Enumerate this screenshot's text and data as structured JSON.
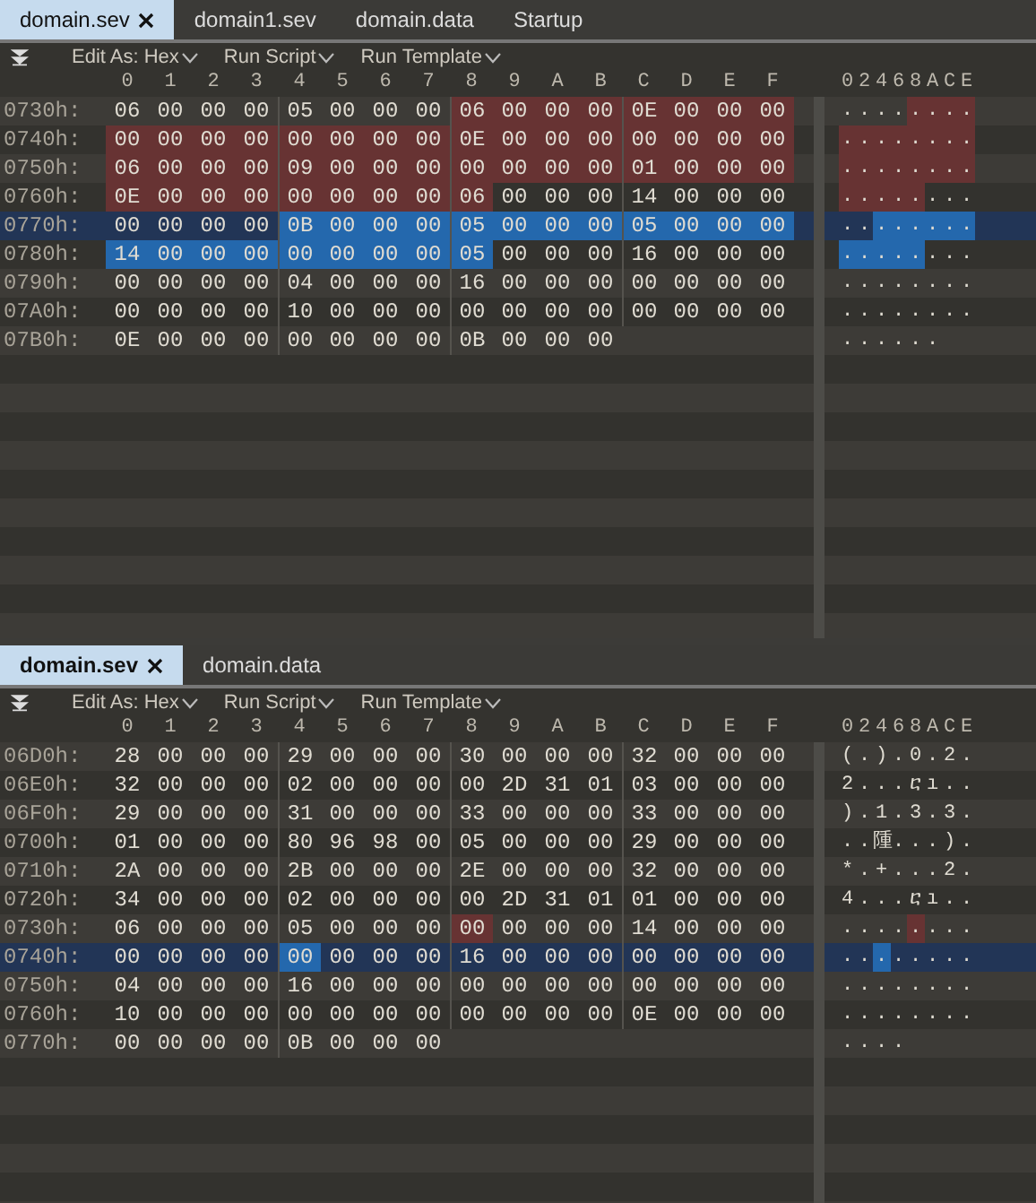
{
  "panes": [
    {
      "tabs": [
        {
          "label": "domain.sev",
          "selected": true,
          "focused": false,
          "closable": true
        },
        {
          "label": "domain1.sev",
          "selected": false,
          "focused": false,
          "closable": false
        },
        {
          "label": "domain.data",
          "selected": false,
          "focused": false,
          "closable": false
        },
        {
          "label": "Startup",
          "selected": false,
          "focused": false,
          "closable": false
        }
      ],
      "toolbar": [
        "Edit As: Hex",
        "Run Script",
        "Run Template"
      ],
      "columns": [
        "0",
        "1",
        "2",
        "3",
        "4",
        "5",
        "6",
        "7",
        "8",
        "9",
        "A",
        "B",
        "C",
        "D",
        "E",
        "F"
      ],
      "text_columns": [
        "0",
        "2",
        "4",
        "6",
        "8",
        "A",
        "C",
        "E"
      ],
      "rows": [
        {
          "offset": "0730h:",
          "selected": false,
          "bytes": [
            "06",
            "00",
            "00",
            "00",
            "05",
            "00",
            "00",
            "00",
            "06",
            "00",
            "00",
            "00",
            "0E",
            "00",
            "00",
            "00"
          ],
          "in_template": [
            false,
            false,
            false,
            false,
            false,
            false,
            false,
            false,
            true,
            true,
            true,
            true,
            true,
            true,
            true,
            true
          ],
          "selected_bytes": [
            false,
            false,
            false,
            false,
            false,
            false,
            false,
            false,
            false,
            false,
            false,
            false,
            false,
            false,
            false,
            false
          ],
          "text": "........"
        },
        {
          "offset": "0740h:",
          "selected": false,
          "bytes": [
            "00",
            "00",
            "00",
            "00",
            "00",
            "00",
            "00",
            "00",
            "0E",
            "00",
            "00",
            "00",
            "00",
            "00",
            "00",
            "00"
          ],
          "in_template": [
            true,
            true,
            true,
            true,
            true,
            true,
            true,
            true,
            true,
            true,
            true,
            true,
            true,
            true,
            true,
            true
          ],
          "selected_bytes": [
            false,
            false,
            false,
            false,
            false,
            false,
            false,
            false,
            false,
            false,
            false,
            false,
            false,
            false,
            false,
            false
          ],
          "text": "........"
        },
        {
          "offset": "0750h:",
          "selected": false,
          "bytes": [
            "06",
            "00",
            "00",
            "00",
            "09",
            "00",
            "00",
            "00",
            "00",
            "00",
            "00",
            "00",
            "01",
            "00",
            "00",
            "00"
          ],
          "in_template": [
            true,
            true,
            true,
            true,
            true,
            true,
            true,
            true,
            true,
            true,
            true,
            true,
            true,
            true,
            true,
            true
          ],
          "selected_bytes": [
            false,
            false,
            false,
            false,
            false,
            false,
            false,
            false,
            false,
            false,
            false,
            false,
            false,
            false,
            false,
            false
          ],
          "text": "........"
        },
        {
          "offset": "0760h:",
          "selected": false,
          "bytes": [
            "0E",
            "00",
            "00",
            "00",
            "00",
            "00",
            "00",
            "00",
            "06",
            "00",
            "00",
            "00",
            "14",
            "00",
            "00",
            "00"
          ],
          "in_template": [
            true,
            true,
            true,
            true,
            true,
            true,
            true,
            true,
            true,
            false,
            false,
            false,
            false,
            false,
            false,
            false
          ],
          "selected_bytes": [
            false,
            false,
            false,
            false,
            false,
            false,
            false,
            false,
            false,
            false,
            false,
            false,
            false,
            false,
            false,
            false
          ],
          "text": "........"
        },
        {
          "offset": "0770h:",
          "selected": true,
          "bytes": [
            "00",
            "00",
            "00",
            "00",
            "0B",
            "00",
            "00",
            "00",
            "05",
            "00",
            "00",
            "00",
            "05",
            "00",
            "00",
            "00"
          ],
          "in_template": [
            false,
            false,
            false,
            false,
            false,
            false,
            false,
            false,
            false,
            false,
            false,
            false,
            false,
            false,
            false,
            false
          ],
          "selected_bytes": [
            false,
            false,
            false,
            false,
            true,
            true,
            true,
            true,
            true,
            true,
            true,
            true,
            true,
            true,
            true,
            true
          ],
          "text": "........"
        },
        {
          "offset": "0780h:",
          "selected": false,
          "bytes": [
            "14",
            "00",
            "00",
            "00",
            "00",
            "00",
            "00",
            "00",
            "05",
            "00",
            "00",
            "00",
            "16",
            "00",
            "00",
            "00"
          ],
          "in_template": [
            false,
            false,
            false,
            false,
            false,
            false,
            false,
            false,
            false,
            false,
            false,
            false,
            false,
            false,
            false,
            false
          ],
          "selected_bytes": [
            true,
            true,
            true,
            true,
            true,
            true,
            true,
            true,
            true,
            false,
            false,
            false,
            false,
            false,
            false,
            false
          ],
          "text": "........"
        },
        {
          "offset": "0790h:",
          "selected": false,
          "bytes": [
            "00",
            "00",
            "00",
            "00",
            "04",
            "00",
            "00",
            "00",
            "16",
            "00",
            "00",
            "00",
            "00",
            "00",
            "00",
            "00"
          ],
          "in_template": [
            false,
            false,
            false,
            false,
            false,
            false,
            false,
            false,
            false,
            false,
            false,
            false,
            false,
            false,
            false,
            false
          ],
          "selected_bytes": [
            false,
            false,
            false,
            false,
            false,
            false,
            false,
            false,
            false,
            false,
            false,
            false,
            false,
            false,
            false,
            false
          ],
          "text": "........"
        },
        {
          "offset": "07A0h:",
          "selected": false,
          "bytes": [
            "00",
            "00",
            "00",
            "00",
            "10",
            "00",
            "00",
            "00",
            "00",
            "00",
            "00",
            "00",
            "00",
            "00",
            "00",
            "00"
          ],
          "in_template": [
            false,
            false,
            false,
            false,
            false,
            false,
            false,
            false,
            false,
            false,
            false,
            false,
            false,
            false,
            false,
            false
          ],
          "selected_bytes": [
            false,
            false,
            false,
            false,
            false,
            false,
            false,
            false,
            false,
            false,
            false,
            false,
            false,
            false,
            false,
            false
          ],
          "text": "........"
        },
        {
          "offset": "07B0h:",
          "selected": false,
          "bytes": [
            "0E",
            "00",
            "00",
            "00",
            "00",
            "00",
            "00",
            "00",
            "0B",
            "00",
            "00",
            "00"
          ],
          "in_template": [
            false,
            false,
            false,
            false,
            false,
            false,
            false,
            false,
            false,
            false,
            false,
            false
          ],
          "selected_bytes": [
            false,
            false,
            false,
            false,
            false,
            false,
            false,
            false,
            false,
            false,
            false,
            false
          ],
          "text": "......"
        }
      ]
    },
    {
      "tabs": [
        {
          "label": "domain.sev",
          "selected": true,
          "focused": true,
          "closable": true
        },
        {
          "label": "domain.data",
          "selected": false,
          "focused": false,
          "closable": false
        }
      ],
      "toolbar": [
        "Edit As: Hex",
        "Run Script",
        "Run Template"
      ],
      "columns": [
        "0",
        "1",
        "2",
        "3",
        "4",
        "5",
        "6",
        "7",
        "8",
        "9",
        "A",
        "B",
        "C",
        "D",
        "E",
        "F"
      ],
      "text_columns": [
        "0",
        "2",
        "4",
        "6",
        "8",
        "A",
        "C",
        "E"
      ],
      "rows": [
        {
          "offset": "06D0h:",
          "selected": false,
          "bytes": [
            "28",
            "00",
            "00",
            "00",
            "29",
            "00",
            "00",
            "00",
            "30",
            "00",
            "00",
            "00",
            "32",
            "00",
            "00",
            "00"
          ],
          "in_template": [
            false,
            false,
            false,
            false,
            false,
            false,
            false,
            false,
            false,
            false,
            false,
            false,
            false,
            false,
            false,
            false
          ],
          "selected_bytes": [
            false,
            false,
            false,
            false,
            false,
            false,
            false,
            false,
            false,
            false,
            false,
            false,
            false,
            false,
            false,
            false
          ],
          "text": "(.).0.2."
        },
        {
          "offset": "06E0h:",
          "selected": false,
          "bytes": [
            "32",
            "00",
            "00",
            "00",
            "02",
            "00",
            "00",
            "00",
            "00",
            "2D",
            "31",
            "01",
            "03",
            "00",
            "00",
            "00"
          ],
          "in_template": [
            false,
            false,
            false,
            false,
            false,
            false,
            false,
            false,
            false,
            false,
            false,
            false,
            false,
            false,
            false,
            false
          ],
          "selected_bytes": [
            false,
            false,
            false,
            false,
            false,
            false,
            false,
            false,
            false,
            false,
            false,
            false,
            false,
            false,
            false,
            false
          ],
          "text": "2...ⴀı.."
        },
        {
          "offset": "06F0h:",
          "selected": false,
          "bytes": [
            "29",
            "00",
            "00",
            "00",
            "31",
            "00",
            "00",
            "00",
            "33",
            "00",
            "00",
            "00",
            "33",
            "00",
            "00",
            "00"
          ],
          "in_template": [
            false,
            false,
            false,
            false,
            false,
            false,
            false,
            false,
            false,
            false,
            false,
            false,
            false,
            false,
            false,
            false
          ],
          "selected_bytes": [
            false,
            false,
            false,
            false,
            false,
            false,
            false,
            false,
            false,
            false,
            false,
            false,
            false,
            false,
            false,
            false
          ],
          "text": ").1.3.3."
        },
        {
          "offset": "0700h:",
          "selected": false,
          "bytes": [
            "01",
            "00",
            "00",
            "00",
            "80",
            "96",
            "98",
            "00",
            "05",
            "00",
            "00",
            "00",
            "29",
            "00",
            "00",
            "00"
          ],
          "in_template": [
            false,
            false,
            false,
            false,
            false,
            false,
            false,
            false,
            false,
            false,
            false,
            false,
            false,
            false,
            false,
            false
          ],
          "selected_bytes": [
            false,
            false,
            false,
            false,
            false,
            false,
            false,
            false,
            false,
            false,
            false,
            false,
            false,
            false,
            false,
            false
          ],
          "text": "..隀...)."
        },
        {
          "offset": "0710h:",
          "selected": false,
          "bytes": [
            "2A",
            "00",
            "00",
            "00",
            "2B",
            "00",
            "00",
            "00",
            "2E",
            "00",
            "00",
            "00",
            "32",
            "00",
            "00",
            "00"
          ],
          "in_template": [
            false,
            false,
            false,
            false,
            false,
            false,
            false,
            false,
            false,
            false,
            false,
            false,
            false,
            false,
            false,
            false
          ],
          "selected_bytes": [
            false,
            false,
            false,
            false,
            false,
            false,
            false,
            false,
            false,
            false,
            false,
            false,
            false,
            false,
            false,
            false
          ],
          "text": "*.+...2."
        },
        {
          "offset": "0720h:",
          "selected": false,
          "bytes": [
            "34",
            "00",
            "00",
            "00",
            "02",
            "00",
            "00",
            "00",
            "00",
            "2D",
            "31",
            "01",
            "01",
            "00",
            "00",
            "00"
          ],
          "in_template": [
            false,
            false,
            false,
            false,
            false,
            false,
            false,
            false,
            false,
            false,
            false,
            false,
            false,
            false,
            false,
            false
          ],
          "selected_bytes": [
            false,
            false,
            false,
            false,
            false,
            false,
            false,
            false,
            false,
            false,
            false,
            false,
            false,
            false,
            false,
            false
          ],
          "text": "4...ⴀı.."
        },
        {
          "offset": "0730h:",
          "selected": false,
          "bytes": [
            "06",
            "00",
            "00",
            "00",
            "05",
            "00",
            "00",
            "00",
            "00",
            "00",
            "00",
            "00",
            "14",
            "00",
            "00",
            "00"
          ],
          "in_template": [
            false,
            false,
            false,
            false,
            false,
            false,
            false,
            false,
            true,
            false,
            false,
            false,
            false,
            false,
            false,
            false
          ],
          "selected_bytes": [
            false,
            false,
            false,
            false,
            false,
            false,
            false,
            false,
            false,
            false,
            false,
            false,
            false,
            false,
            false,
            false
          ],
          "text": "........"
        },
        {
          "offset": "0740h:",
          "selected": true,
          "bytes": [
            "00",
            "00",
            "00",
            "00",
            "00",
            "00",
            "00",
            "00",
            "16",
            "00",
            "00",
            "00",
            "00",
            "00",
            "00",
            "00"
          ],
          "in_template": [
            false,
            false,
            false,
            false,
            false,
            false,
            false,
            false,
            false,
            false,
            false,
            false,
            false,
            false,
            false,
            false
          ],
          "selected_bytes": [
            false,
            false,
            false,
            false,
            true,
            false,
            false,
            false,
            false,
            false,
            false,
            false,
            false,
            false,
            false,
            false
          ],
          "text": "........"
        },
        {
          "offset": "0750h:",
          "selected": false,
          "bytes": [
            "04",
            "00",
            "00",
            "00",
            "16",
            "00",
            "00",
            "00",
            "00",
            "00",
            "00",
            "00",
            "00",
            "00",
            "00",
            "00"
          ],
          "in_template": [
            false,
            false,
            false,
            false,
            false,
            false,
            false,
            false,
            false,
            false,
            false,
            false,
            false,
            false,
            false,
            false
          ],
          "selected_bytes": [
            false,
            false,
            false,
            false,
            false,
            false,
            false,
            false,
            false,
            false,
            false,
            false,
            false,
            false,
            false,
            false
          ],
          "text": "........"
        },
        {
          "offset": "0760h:",
          "selected": false,
          "bytes": [
            "10",
            "00",
            "00",
            "00",
            "00",
            "00",
            "00",
            "00",
            "00",
            "00",
            "00",
            "00",
            "0E",
            "00",
            "00",
            "00"
          ],
          "in_template": [
            false,
            false,
            false,
            false,
            false,
            false,
            false,
            false,
            false,
            false,
            false,
            false,
            false,
            false,
            false,
            false
          ],
          "selected_bytes": [
            false,
            false,
            false,
            false,
            false,
            false,
            false,
            false,
            false,
            false,
            false,
            false,
            false,
            false,
            false,
            false
          ],
          "text": "........"
        },
        {
          "offset": "0770h:",
          "selected": false,
          "bytes": [
            "00",
            "00",
            "00",
            "00",
            "0B",
            "00",
            "00",
            "00"
          ],
          "in_template": [
            false,
            false,
            false,
            false,
            false,
            false,
            false,
            false
          ],
          "selected_bytes": [
            false,
            false,
            false,
            false,
            false,
            false,
            false,
            false
          ],
          "text": "...."
        }
      ]
    }
  ]
}
